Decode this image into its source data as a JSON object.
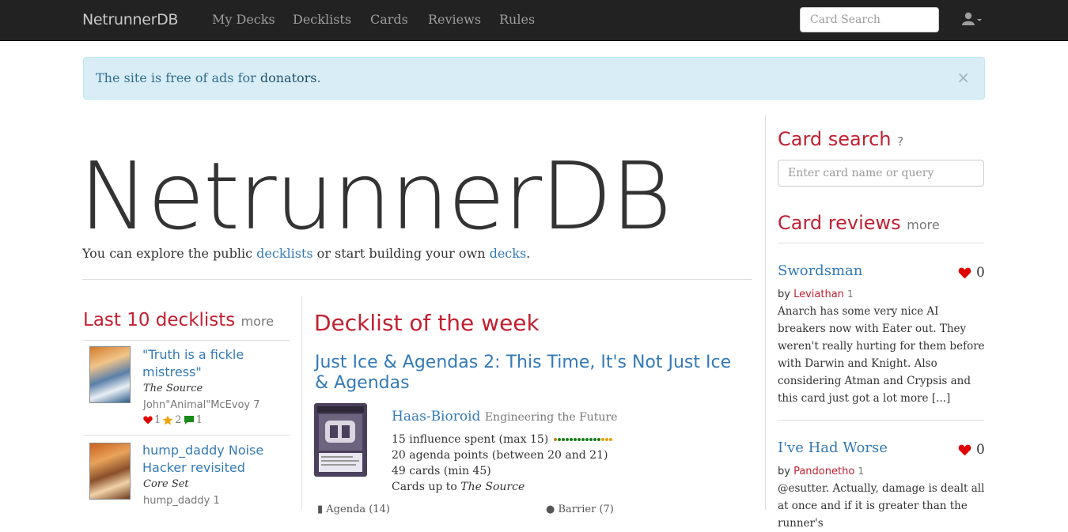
{
  "navbar": {
    "brand": "NetrunnerDB",
    "links": [
      "My Decks",
      "Decklists",
      "Cards",
      "Reviews",
      "Rules"
    ],
    "search_placeholder": "Card Search"
  },
  "alert": {
    "text_before": "The site is free of ads for ",
    "link": "donators",
    "text_after": ".",
    "close": "×"
  },
  "hero": {
    "title": "NetrunnerDB",
    "sub_before": "You can explore the public ",
    "sub_link1": "decklists",
    "sub_middle": " or start building your own ",
    "sub_link2": "decks",
    "sub_after": "."
  },
  "last_decklists": {
    "heading": "Last 10 decklists",
    "more": "more",
    "items": [
      {
        "title": "\"Truth is a fickle mistress\"",
        "pack": "The Source",
        "author": "John\"Animal\"McEvoy",
        "rep": "7",
        "likes": "1",
        "favorites": "2",
        "comments": "1"
      },
      {
        "title": "hump_daddy Noise Hacker revisited",
        "pack": "Core Set",
        "author": "hump_daddy",
        "rep": "1"
      }
    ]
  },
  "decklist_of_week": {
    "heading": "Decklist of the week",
    "title": "Just Ice & Agendas 2: This Time, It's Not Just Ice & Agendas",
    "identity": "Haas-Bioroid",
    "identity_subtitle": "Engineering the Future",
    "influence": "15 influence spent (max 15)",
    "agenda": "20 agenda points (between 20 and 21)",
    "cards": "49 cards (min 45)",
    "cards_up_to": "Cards up to ",
    "cards_up_to_pack": "The Source",
    "section_agenda": "Agenda (14)",
    "section_barrier": "Barrier (7)"
  },
  "card_search": {
    "heading": "Card search",
    "help": "?",
    "placeholder": "Enter card name or query"
  },
  "card_reviews": {
    "heading": "Card reviews",
    "more": "more",
    "items": [
      {
        "card": "Swordsman",
        "likes": "0",
        "by": "by ",
        "author": "Leviathan",
        "rep": "1",
        "body": "Anarch has some very nice AI breakers now with Eater out. They weren't really hurting for them before with Darwin and Knight. Also considering Atman and Crypsis and this card just got a lot more [...]"
      },
      {
        "card": "I've Had Worse",
        "likes": "0",
        "by": "by ",
        "author": "Pandonetho",
        "rep": "1",
        "body": "@esutter. Actually, damage is dealt all at once and if it is greater than the runner's"
      }
    ]
  },
  "colors": {
    "accent": "#c22031",
    "link": "#337ab7",
    "navbar": "#222222",
    "alert_bg": "#d9edf7"
  }
}
